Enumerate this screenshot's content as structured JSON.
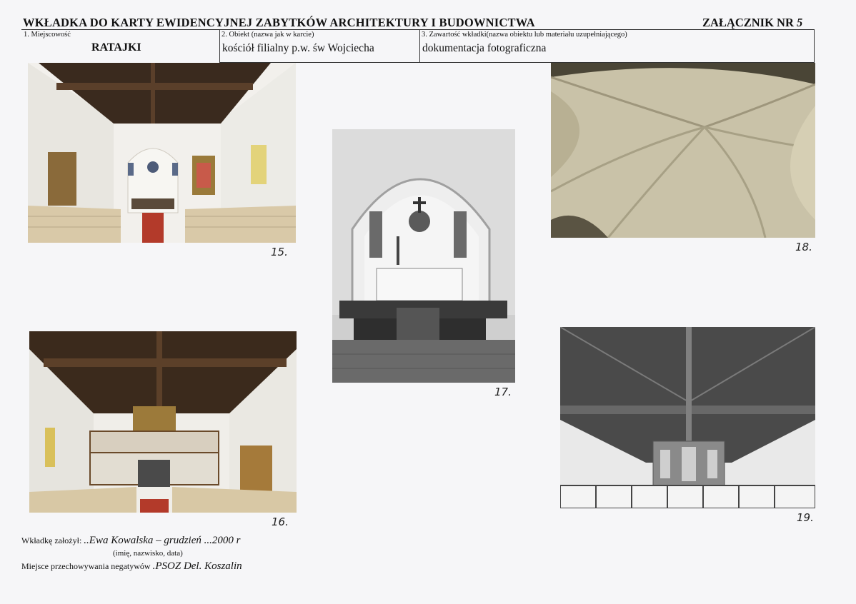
{
  "header": {
    "title": "WKŁADKA DO KARTY EWIDENCYJNEJ ZABYTKÓW ARCHITEKTURY I BUDOWNICTWA",
    "annex_label": "ZAŁĄCZNIK NR",
    "annex_number": "5"
  },
  "fields": [
    {
      "label": "1. Miejscowość",
      "value": "RATAJKI"
    },
    {
      "label": "2. Obiekt (nazwa jak w karcie)",
      "value": "kościół filialny p.w. św Wojciecha"
    },
    {
      "label": "3. Zawartość wkładki(nazwa obiektu lub materiału uzupełniającego)",
      "value": "dokumentacja fotograficzna"
    }
  ],
  "photos": [
    {
      "number": "15."
    },
    {
      "number": "16."
    },
    {
      "number": "17."
    },
    {
      "number": "18."
    },
    {
      "number": "19."
    }
  ],
  "footer": {
    "author_label": "Wkładkę założył:",
    "author_value": "..Ewa Kowalska – grudzień ...2000 r",
    "author_hint": "(imię, nazwisko, data)",
    "storage_label": "Miejsce przechowywania negatywów",
    "storage_value": ".PSOZ Del. Koszalin"
  }
}
